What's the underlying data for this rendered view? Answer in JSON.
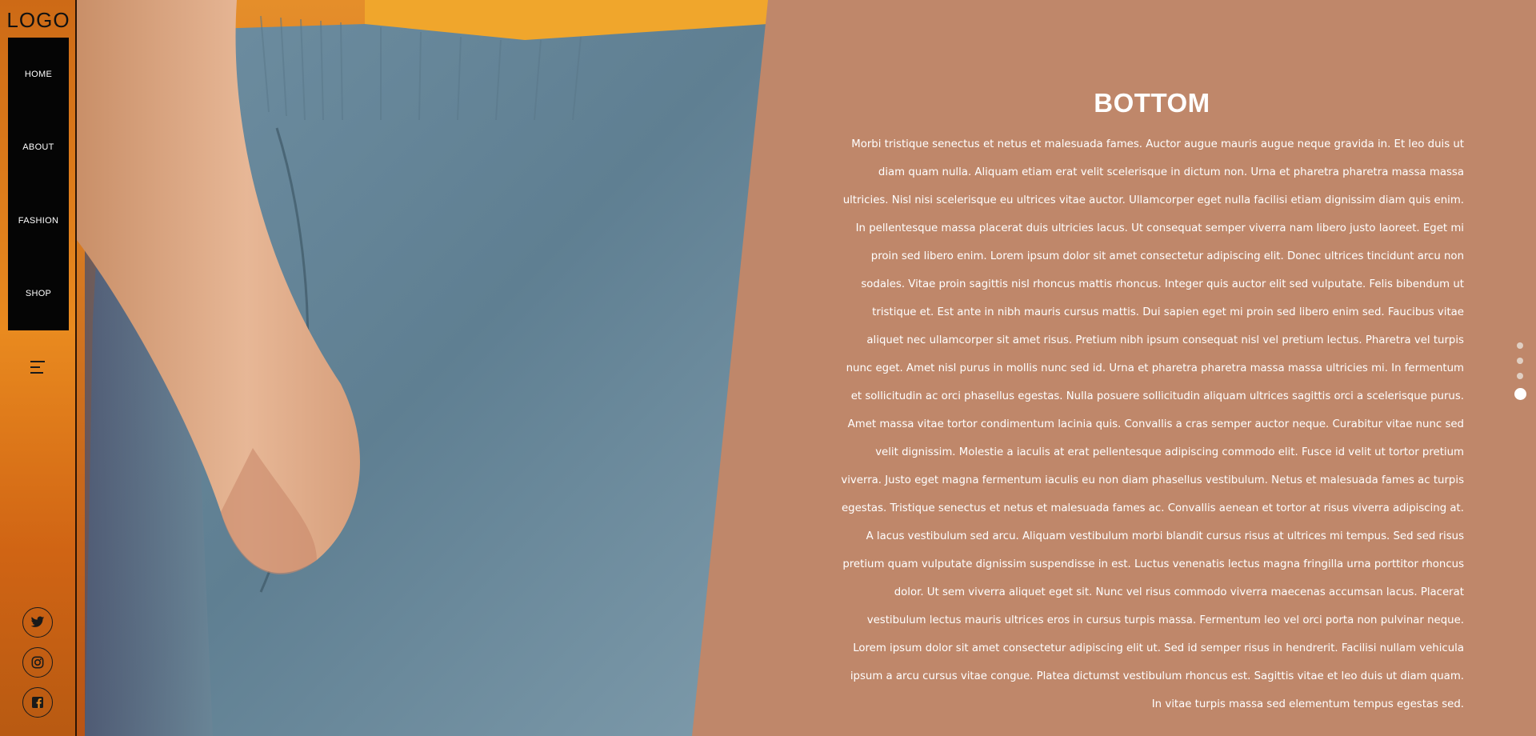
{
  "logo": "LOGO",
  "nav": {
    "items": [
      {
        "label": "HOME"
      },
      {
        "label": "ABOUT"
      },
      {
        "label": "FASHION"
      },
      {
        "label": "SHOP"
      }
    ]
  },
  "menu_icon": "menu-icon",
  "social": [
    {
      "icon": "twitter-icon"
    },
    {
      "icon": "instagram-icon"
    },
    {
      "icon": "facebook-icon"
    }
  ],
  "section": {
    "title": "BOTTOM",
    "body": "Morbi tristique senectus et netus et malesuada fames. Auctor augue mauris augue neque gravida in. Et leo duis ut diam quam nulla. Aliquam etiam erat velit scelerisque in dictum non. Urna et pharetra pharetra massa massa ultricies. Nisl nisi scelerisque eu ultrices vitae auctor. Ullamcorper eget nulla facilisi etiam dignissim diam quis enim. In pellentesque massa placerat duis ultricies lacus. Ut consequat semper viverra nam libero justo laoreet. Eget mi proin sed libero enim. Lorem ipsum dolor sit amet consectetur adipiscing elit. Donec ultrices tincidunt arcu non sodales. Vitae proin sagittis nisl rhoncus mattis rhoncus. Integer quis auctor elit sed vulputate. Felis bibendum ut tristique et. Est ante in nibh mauris cursus mattis. Dui sapien eget mi proin sed libero enim sed. Faucibus vitae aliquet nec ullamcorper sit amet risus. Pretium nibh ipsum consequat nisl vel pretium lectus. Pharetra vel turpis nunc eget. Amet nisl purus in mollis nunc sed id. Urna et pharetra pharetra massa massa ultricies mi. In fermentum et sollicitudin ac orci phasellus egestas. Nulla posuere sollicitudin aliquam ultrices sagittis orci a scelerisque purus. Amet massa vitae tortor condimentum lacinia quis. Convallis a cras semper auctor neque. Curabitur vitae nunc sed velit dignissim. Molestie a iaculis at erat pellentesque adipiscing commodo elit. Fusce id velit ut tortor pretium viverra. Justo eget magna fermentum iaculis eu non diam phasellus vestibulum. Netus et malesuada fames ac turpis egestas. Tristique senectus et netus et malesuada fames ac. Convallis aenean et tortor at risus viverra adipiscing at. A lacus vestibulum sed arcu. Aliquam vestibulum morbi blandit cursus risus at ultrices mi tempus. Sed sed risus pretium quam vulputate dignissim suspendisse in est. Luctus venenatis lectus magna fringilla urna porttitor rhoncus dolor. Ut sem viverra aliquet eget sit. Nunc vel risus commodo viverra maecenas accumsan lacus. Placerat vestibulum lectus mauris ultrices eros in cursus turpis massa. Fermentum leo vel orci porta non pulvinar neque. Lorem ipsum dolor sit amet consectetur adipiscing elit ut. Sed id semper risus in hendrerit. Facilisi nullam vehicula ipsum a arcu cursus vitae congue. Platea dictumst vestibulum rhoncus est. Sagittis vitae et leo duis ut diam quam. In vitae turpis massa sed elementum tempus egestas sed."
  },
  "pager": {
    "count": 4,
    "active_index": 3
  },
  "colors": {
    "panel": "#bf876a",
    "sidebar_accent": "#e98a1f",
    "nav_background": "#050505",
    "text": "#ffffff"
  }
}
